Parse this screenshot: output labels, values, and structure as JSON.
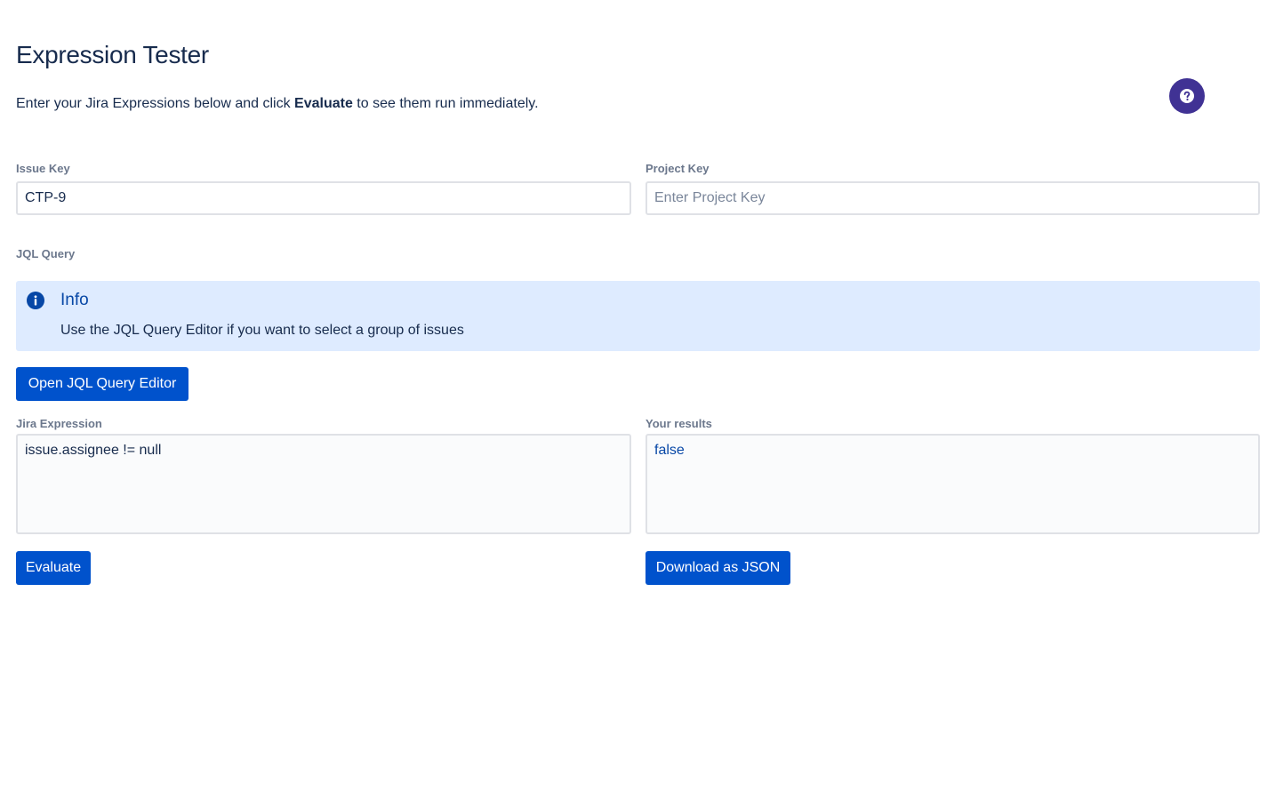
{
  "header": {
    "title": "Expression Tester",
    "subtitle_before": "Enter your Jira Expressions below and click ",
    "subtitle_bold": "Evaluate",
    "subtitle_after": " to see them run immediately.",
    "help_icon": "question-circle-icon"
  },
  "issue_key": {
    "label": "Issue Key",
    "value": "CTP-9",
    "placeholder": ""
  },
  "project_key": {
    "label": "Project Key",
    "value": "",
    "placeholder": "Enter Project Key"
  },
  "jql": {
    "label": "JQL Query",
    "info_title": "Info",
    "info_text": "Use the JQL Query Editor if you want to select a group of issues",
    "info_icon": "info-circle-icon",
    "open_editor_label": "Open JQL Query Editor"
  },
  "expression": {
    "label": "Jira Expression",
    "value": "issue.assignee != null",
    "evaluate_label": "Evaluate"
  },
  "results": {
    "label": "Your results",
    "value": "false",
    "download_label": "Download as JSON"
  },
  "colors": {
    "primary": "#0052cc",
    "help_button": "#403294",
    "info_background": "#deebff",
    "heading": "#172b4d",
    "label": "#6b778c"
  }
}
